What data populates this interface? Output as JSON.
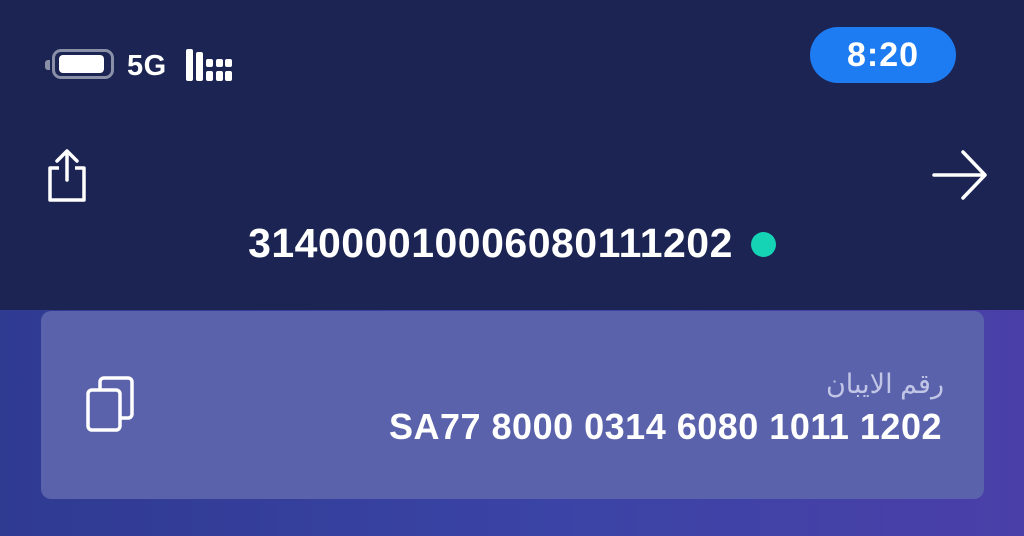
{
  "status_bar": {
    "network": "5G",
    "time": "8:20",
    "battery_icon": "battery-icon",
    "signal_icon": "signal-bars-icon"
  },
  "header": {
    "share_icon": "share-icon",
    "forward_icon": "arrow-right-icon",
    "account_number": "314000010006080111202",
    "status_color": "#15d3b5"
  },
  "iban_card": {
    "label": "رقم الايبان",
    "value": "SA77 8000 0314 6080 1011 1202",
    "copy_icon": "copy-icon"
  },
  "colors": {
    "background": "#1b2452",
    "accent": "#1e7cf2",
    "card": "#5a62ac"
  }
}
